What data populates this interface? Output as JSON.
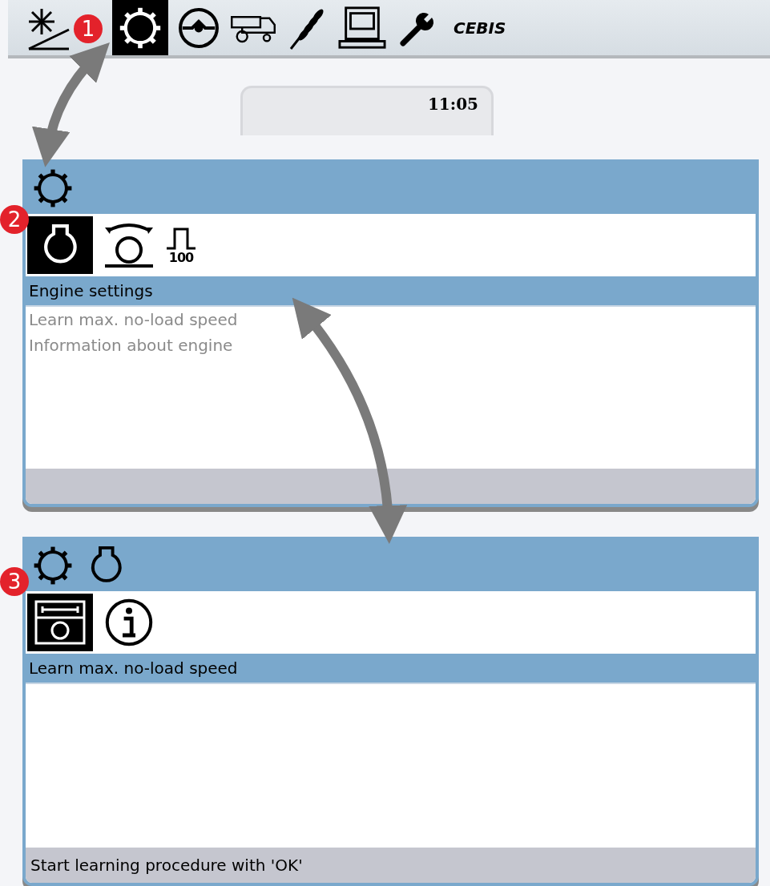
{
  "top_bar": {
    "items": [
      {
        "kind": "sun-slope",
        "selected": false
      },
      {
        "kind": "gear",
        "selected": true
      },
      {
        "kind": "steering",
        "selected": false
      },
      {
        "kind": "combine",
        "selected": false
      },
      {
        "kind": "grain",
        "selected": false
      },
      {
        "kind": "counter",
        "selected": false
      },
      {
        "kind": "wrench",
        "selected": false
      },
      {
        "kind": "text",
        "label": "CEBIS",
        "selected": false
      }
    ]
  },
  "dashboard": {
    "clock": "11:05"
  },
  "panels": [
    {
      "breadcrumb": [
        {
          "kind": "gear"
        }
      ],
      "tabs": [
        {
          "kind": "engine",
          "selected": true
        },
        {
          "kind": "wheel-slip",
          "selected": false
        },
        {
          "kind": "pulse",
          "label": "100",
          "selected": false
        }
      ],
      "title": "Engine settings",
      "items": [
        "Learn max. no-load speed",
        "Information about engine"
      ]
    },
    {
      "breadcrumb": [
        {
          "kind": "gear"
        },
        {
          "kind": "engine"
        }
      ],
      "tabs": [
        {
          "kind": "learn",
          "selected": true
        },
        {
          "kind": "info",
          "selected": false
        }
      ],
      "title": "Learn max. no-load speed",
      "status": "Start learning procedure with 'OK'"
    }
  ],
  "callouts": [
    "1",
    "2",
    "3"
  ]
}
